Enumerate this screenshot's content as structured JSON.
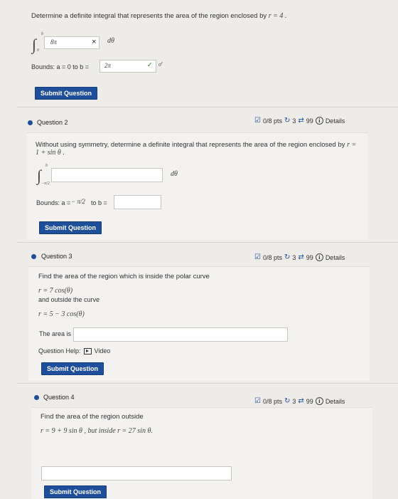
{
  "q1": {
    "prompt": "Determine a definite integral that represents the area of the region enclosed by",
    "curve": "r = 4 .",
    "lower_limit": "0",
    "upper_limit": "b",
    "integrand_value": "8π",
    "clear_icon": "×",
    "differential": "dθ",
    "bounds_label": "Bounds: a = 0 to b =",
    "upper_bound_value": "2π",
    "check_icon": "✓",
    "submit_label": "Submit Question"
  },
  "q2": {
    "title": "Question 2",
    "score": "0/8 pts",
    "retries": "3",
    "attempts": "99",
    "details": "Details",
    "prompt": "Without using symmetry, determine a definite integral that represents the area of the region enclosed by",
    "curve": "r = 1 + sin θ .",
    "lower_limit": "−π/2",
    "upper_limit": "b",
    "differential": "dθ",
    "bounds_label": "Bounds: a =",
    "bounds_value": "− π/2",
    "to_b": "to b =",
    "submit_label": "Submit Question"
  },
  "q3": {
    "title": "Question 3",
    "score": "0/8 pts",
    "retries": "3",
    "attempts": "99",
    "details": "Details",
    "prompt": "Find the area of the region which is inside the polar curve",
    "curve1": "r = 7 cos(θ)",
    "and_outside": "and outside the curve",
    "curve2": "r = 5 − 3 cos(θ)",
    "area_label": "The area is",
    "help_label": "Question Help:",
    "video_label": "Video",
    "submit_label": "Submit Question"
  },
  "q4": {
    "title": "Question 4",
    "score": "0/8 pts",
    "retries": "3",
    "attempts": "99",
    "details": "Details",
    "prompt": "Find the area of the region outside",
    "curve": "r = 9 + 9 sin θ , but inside r = 27 sin θ.",
    "submit_label": "Submit Question"
  }
}
